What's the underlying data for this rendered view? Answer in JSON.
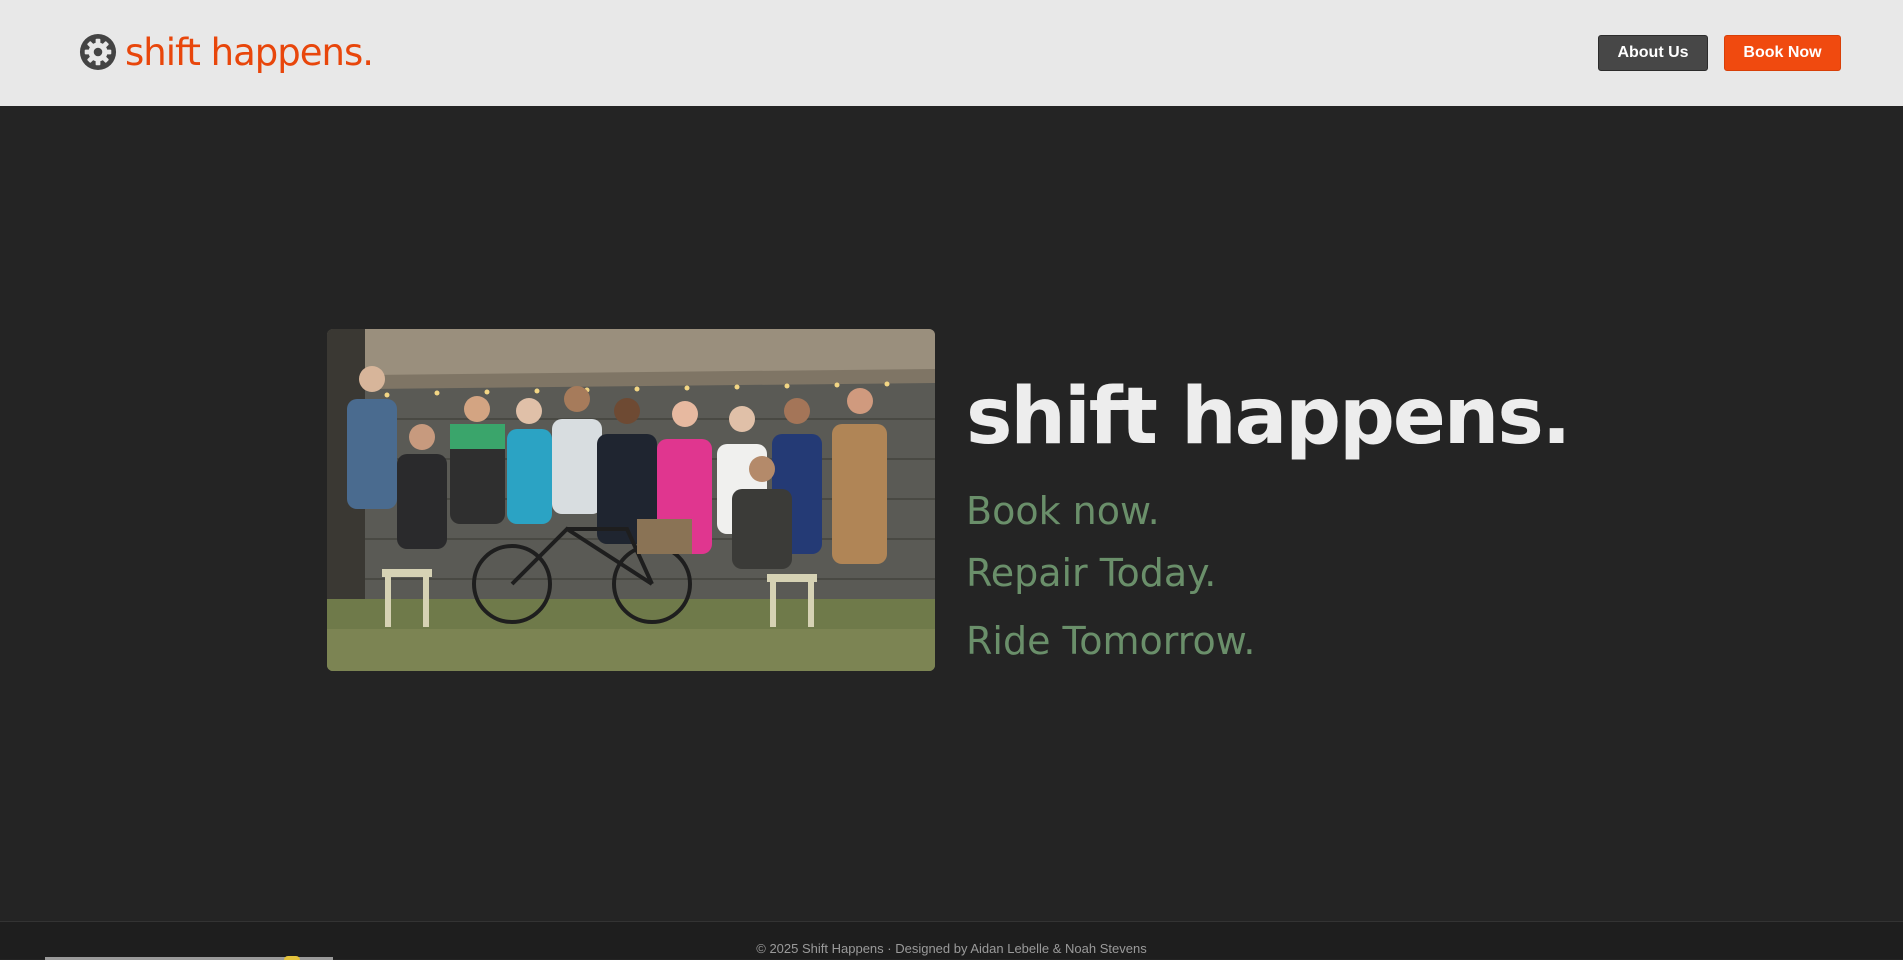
{
  "header": {
    "logo_text": "shift happens.",
    "logo_icon": "gear-icon",
    "about_label": "About Us",
    "book_label": "Book Now"
  },
  "hero": {
    "image_alt": "Group of people posing with a bicycle in front of a thatched workshop",
    "title": "shift happens.",
    "taglines": [
      "Book now.",
      "Repair Today.",
      "Ride Tomorrow."
    ]
  },
  "footer": {
    "text": "© 2025 Shift Happens · Designed by Aidan Lebelle & Noah Stevens"
  },
  "colors": {
    "brand_orange": "#f04a0f",
    "header_bg": "#e8e8e8",
    "page_bg": "#242424",
    "tagline_green": "#6a8f6a"
  }
}
